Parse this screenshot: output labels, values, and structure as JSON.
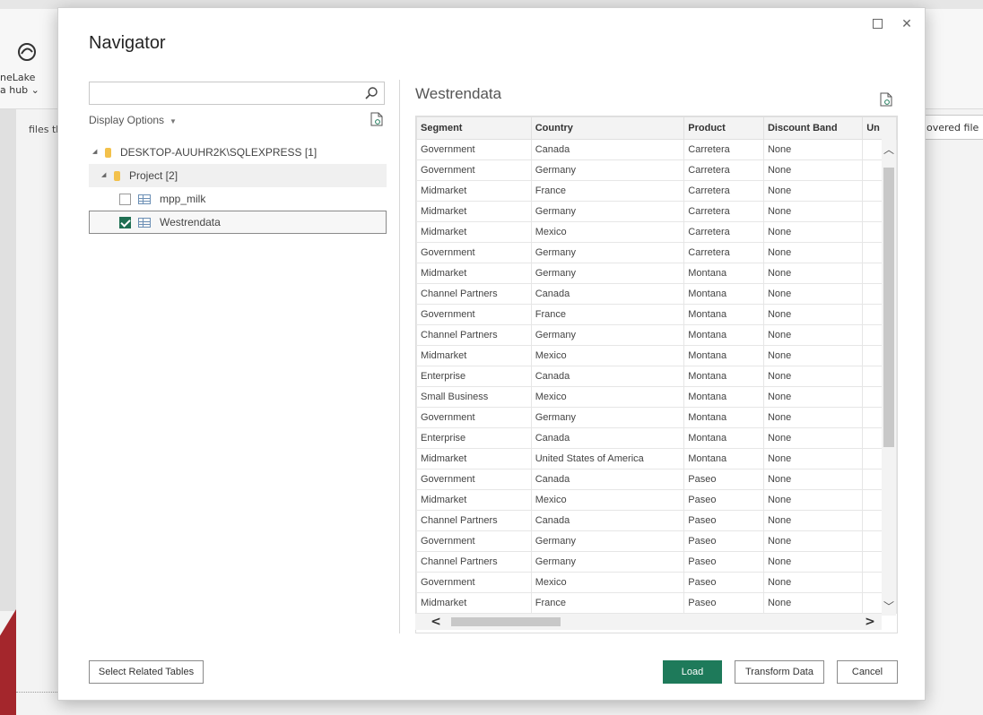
{
  "background": {
    "onelake_label_1": "neLake",
    "onelake_label_2": "a hub",
    "files_text": "files tha",
    "covered_file_text": "overed file"
  },
  "dialog": {
    "title": "Navigator",
    "search": {
      "placeholder": "",
      "value": ""
    },
    "display_options_label": "Display Options",
    "tree": {
      "server": "DESKTOP-AUUHR2K\\SQLEXPRESS [1]",
      "database": "Project [2]",
      "tables": [
        {
          "label": "mpp_milk",
          "checked": false
        },
        {
          "label": "Westrendata",
          "checked": true
        }
      ]
    },
    "preview": {
      "title": "Westrendata",
      "columns": [
        "Segment",
        "Country",
        "Product",
        "Discount Band",
        "Un"
      ],
      "rows": [
        [
          "Government",
          "Canada",
          "Carretera",
          "None",
          ""
        ],
        [
          "Government",
          "Germany",
          "Carretera",
          "None",
          ""
        ],
        [
          "Midmarket",
          "France",
          "Carretera",
          "None",
          ""
        ],
        [
          "Midmarket",
          "Germany",
          "Carretera",
          "None",
          ""
        ],
        [
          "Midmarket",
          "Mexico",
          "Carretera",
          "None",
          ""
        ],
        [
          "Government",
          "Germany",
          "Carretera",
          "None",
          ""
        ],
        [
          "Midmarket",
          "Germany",
          "Montana",
          "None",
          ""
        ],
        [
          "Channel Partners",
          "Canada",
          "Montana",
          "None",
          ""
        ],
        [
          "Government",
          "France",
          "Montana",
          "None",
          ""
        ],
        [
          "Channel Partners",
          "Germany",
          "Montana",
          "None",
          ""
        ],
        [
          "Midmarket",
          "Mexico",
          "Montana",
          "None",
          ""
        ],
        [
          "Enterprise",
          "Canada",
          "Montana",
          "None",
          ""
        ],
        [
          "Small Business",
          "Mexico",
          "Montana",
          "None",
          ""
        ],
        [
          "Government",
          "Germany",
          "Montana",
          "None",
          ""
        ],
        [
          "Enterprise",
          "Canada",
          "Montana",
          "None",
          ""
        ],
        [
          "Midmarket",
          "United States of America",
          "Montana",
          "None",
          ""
        ],
        [
          "Government",
          "Canada",
          "Paseo",
          "None",
          ""
        ],
        [
          "Midmarket",
          "Mexico",
          "Paseo",
          "None",
          ""
        ],
        [
          "Channel Partners",
          "Canada",
          "Paseo",
          "None",
          ""
        ],
        [
          "Government",
          "Germany",
          "Paseo",
          "None",
          ""
        ],
        [
          "Channel Partners",
          "Germany",
          "Paseo",
          "None",
          ""
        ],
        [
          "Government",
          "Mexico",
          "Paseo",
          "None",
          ""
        ],
        [
          "Midmarket",
          "France",
          "Paseo",
          "None",
          ""
        ]
      ]
    },
    "buttons": {
      "select_related": "Select Related Tables",
      "load": "Load",
      "transform": "Transform Data",
      "cancel": "Cancel"
    }
  },
  "colors": {
    "load_button": "#1e7a5a",
    "checkbox_checked": "#1f6f52",
    "database_icon": "#f3c14b",
    "accent_red": "#a4262c"
  },
  "icons": {
    "search": "search-icon",
    "refresh": "refresh-icon",
    "maximize": "maximize-icon",
    "close": "close-icon"
  }
}
